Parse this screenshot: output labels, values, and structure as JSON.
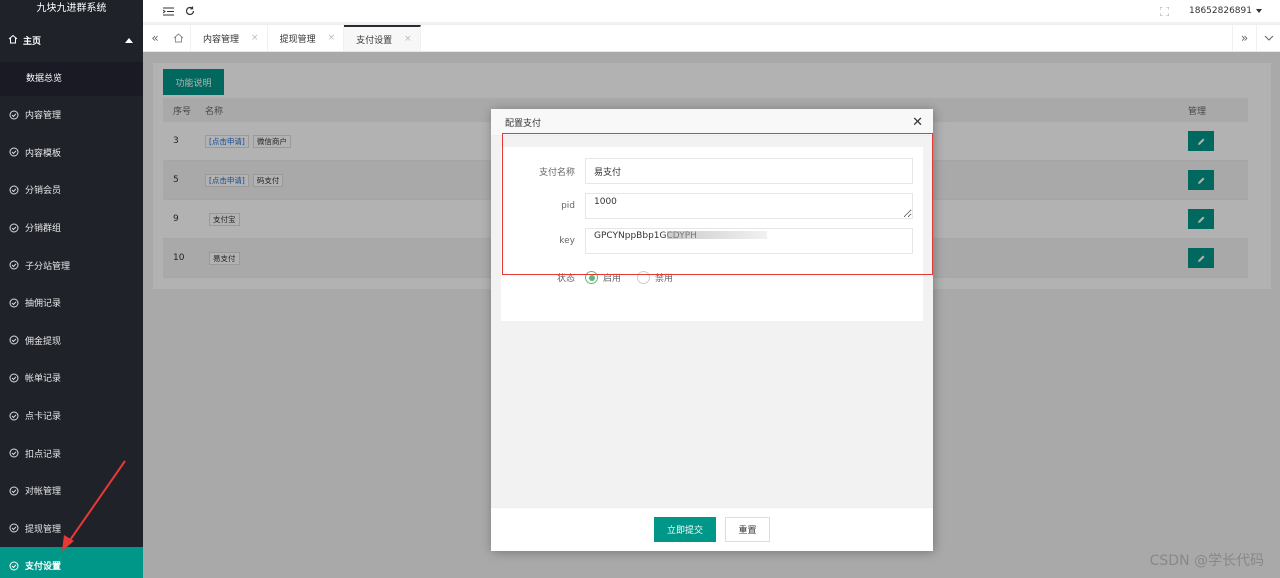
{
  "app": {
    "title": "九块九进群系统"
  },
  "sidebar": {
    "home": {
      "label": "主页"
    },
    "home_sub": {
      "label": "数据总览"
    },
    "items": [
      {
        "label": "内容管理"
      },
      {
        "label": "内容模板"
      },
      {
        "label": "分销会员"
      },
      {
        "label": "分销群组"
      },
      {
        "label": "子分站管理"
      },
      {
        "label": "抽佣记录"
      },
      {
        "label": "佣金提现"
      },
      {
        "label": "帐单记录"
      },
      {
        "label": "点卡记录"
      },
      {
        "label": "扣点记录"
      },
      {
        "label": "对帐管理"
      },
      {
        "label": "提现管理"
      },
      {
        "label": "支付设置",
        "active": true
      }
    ]
  },
  "topbar": {
    "username": "18652826891"
  },
  "tabs": [
    {
      "label": "内容管理"
    },
    {
      "label": "提现管理"
    },
    {
      "label": "支付设置",
      "active": true
    }
  ],
  "content": {
    "func_button": "功能说明",
    "table": {
      "headers": {
        "id": "序号",
        "name": "名称",
        "manage": "管理"
      },
      "rows": [
        {
          "id": "3",
          "tag": "[点击申请]",
          "name": "微信商户"
        },
        {
          "id": "5",
          "tag": "[点击申请]",
          "name": "码支付"
        },
        {
          "id": "9",
          "tag": "",
          "name": "支付宝"
        },
        {
          "id": "10",
          "tag": "",
          "name": "易支付"
        }
      ]
    }
  },
  "dialog": {
    "title": "配置支付",
    "fields": {
      "name_label": "支付名称",
      "name_value": "易支付",
      "pid_label": "pid",
      "pid_value": "1000",
      "key_label": "key",
      "key_value": "GPCYNppBbp1GCDYPH"
    },
    "status": {
      "label": "状态",
      "options": [
        {
          "label": "启用",
          "checked": true
        },
        {
          "label": "禁用",
          "checked": false
        }
      ]
    },
    "submit_label": "立即提交",
    "reset_label": "重置"
  },
  "watermark": "CSDN @学长代码",
  "colors": {
    "accent": "#009688",
    "sidebar_bg": "#20222a",
    "annotation": "#e53935"
  }
}
